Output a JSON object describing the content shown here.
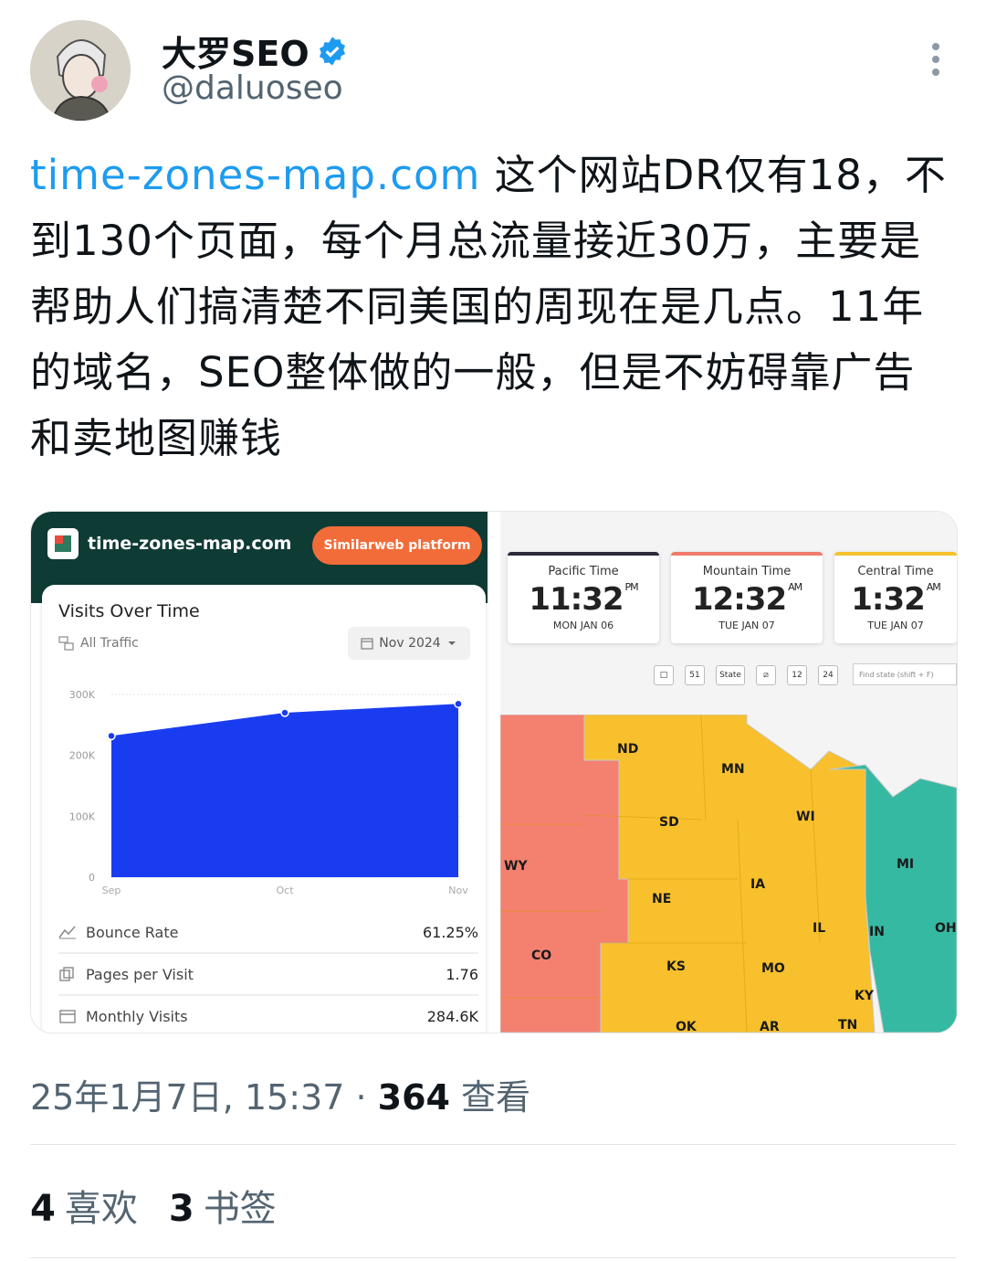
{
  "author": {
    "display_name": "大罗SEO",
    "handle": "@daluoseo",
    "verified_icon": "verified-badge-icon",
    "avatar_icon": "avatar-illustration"
  },
  "tweet": {
    "link_text": "time-zones-map.com",
    "body_text": " 这个网站DR仅有18，不到130个页面，每个月总流量接近30万，主要是帮助人们搞清楚不同美国的周现在是几点。11年的域名，SEO整体做的一般，但是不妨碍靠广告和卖地图赚钱"
  },
  "media_left": {
    "site_name": "time-zones-map.com",
    "platform_button": "Similarweb platform",
    "card_title": "Visits Over Time",
    "traffic_filter": "All Traffic",
    "date_selector": "Nov 2024",
    "metrics": [
      {
        "label": "Bounce Rate",
        "value": "61.25%"
      },
      {
        "label": "Pages per Visit",
        "value": "1.76"
      },
      {
        "label": "Monthly Visits",
        "value": "284.6K"
      }
    ]
  },
  "chart_data": {
    "type": "area",
    "x": [
      "Sep",
      "Oct",
      "Nov"
    ],
    "series": [
      {
        "values": [
          232000,
          270000,
          284600
        ]
      }
    ],
    "yticks": [
      "300K",
      "200K",
      "100K",
      "0"
    ],
    "ylim": [
      0,
      300000
    ],
    "color": "#1a3cf0",
    "grid": true
  },
  "media_right": {
    "clocks": [
      {
        "zone": "Pacific Time",
        "time": "11:32",
        "ampm": "PM",
        "date": "MON JAN 06",
        "color": "#2b2b3a"
      },
      {
        "zone": "Mountain Time",
        "time": "12:32",
        "ampm": "AM",
        "date": "TUE JAN 07",
        "color": "#f07a6a"
      },
      {
        "zone": "Central Time",
        "time": "1:32",
        "ampm": "AM",
        "date": "TUE JAN 07",
        "color": "#f5c22b"
      }
    ],
    "tools": [
      "□",
      "51",
      "State",
      "⧄",
      "12",
      "24"
    ],
    "find_placeholder": "Find state (shift + F)",
    "state_labels": [
      "ND",
      "MN",
      "SD",
      "WI",
      "WY",
      "MI",
      "IA",
      "NE",
      "IL",
      "IN",
      "OH",
      "CO",
      "KS",
      "MO",
      "KY",
      "OK",
      "AR",
      "TN"
    ],
    "zone_colors": {
      "mountain": "#f48170",
      "central": "#f7c02c",
      "eastern": "#36b9a2"
    }
  },
  "footer": {
    "timestamp": "25年1月7日, 15:37 · ",
    "views_count": "364",
    "views_label": " 查看",
    "likes_count": "4",
    "likes_label": "喜欢",
    "bookmarks_count": "3",
    "bookmarks_label": "书签"
  }
}
